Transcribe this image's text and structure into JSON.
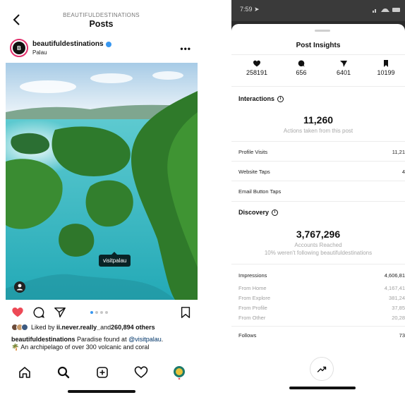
{
  "left": {
    "header": {
      "account_caps": "BEAUTIFULDESTINATIONS",
      "title": "Posts"
    },
    "post": {
      "username": "beautifuldestinations",
      "location": "Palau",
      "avatar_letter": "B",
      "photo_tag": "visitpalau",
      "likes_prefix": "Liked by ",
      "likes_user": "ii.never.really_",
      "likes_mid": " and ",
      "likes_count": "260,894 others",
      "caption_user": "beautifuldestinations",
      "caption_text": " Paradise found at ",
      "caption_mention": "@visitpalau",
      "caption_end": ".",
      "caption_line2": "An archipelago of over 300 volcanic and coral",
      "carousel_dots": 4,
      "carousel_active": 0
    },
    "icons": {
      "back": "chevron-left-icon",
      "more": "more-horizontal-icon",
      "like": "heart-icon",
      "comment": "comment-icon",
      "share": "paper-plane-icon",
      "save": "bookmark-icon",
      "nav": [
        "home-icon",
        "search-icon",
        "add-post-icon",
        "heart-icon",
        "profile-avatar"
      ]
    },
    "colors": {
      "like": "#ed4956",
      "verified": "#3897f0",
      "water": "#3fc7cf"
    }
  },
  "right": {
    "status_time": "7:59",
    "title": "Post Insights",
    "stats": [
      {
        "icon": "heart-icon",
        "value": "258191"
      },
      {
        "icon": "comment-icon",
        "value": "656"
      },
      {
        "icon": "share-icon",
        "value": "6401"
      },
      {
        "icon": "bookmark-icon",
        "value": "10199"
      }
    ],
    "interactions": {
      "heading": "Interactions",
      "total": "11,260",
      "total_label": "Actions taken from this post",
      "rows": [
        {
          "label": "Profile Visits",
          "value": "11,21"
        },
        {
          "label": "Website Taps",
          "value": "4"
        },
        {
          "label": "Email Button Taps",
          "value": ""
        }
      ]
    },
    "discovery": {
      "heading": "Discovery",
      "total": "3,767,296",
      "total_label": "Accounts Reached",
      "note": "10% weren't following beautifuldestinations",
      "rows": [
        {
          "label": "Impressions",
          "value": "4,606,81",
          "sub": false
        },
        {
          "label": "From Home",
          "value": "4,167,41",
          "sub": true
        },
        {
          "label": "From Explore",
          "value": "381,24",
          "sub": true
        },
        {
          "label": "From Profile",
          "value": "37,85",
          "sub": true
        },
        {
          "label": "From Other",
          "value": "20,28",
          "sub": true
        },
        {
          "label": "Follows",
          "value": "73",
          "sub": false
        }
      ]
    },
    "icons": {
      "info": "info-icon",
      "trend": "trending-up-icon"
    }
  }
}
